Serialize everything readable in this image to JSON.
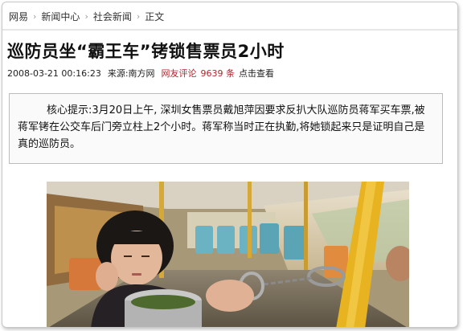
{
  "breadcrumb": {
    "items": [
      "网易",
      "新闻中心",
      "社会新闻",
      "正文"
    ],
    "separator": "›"
  },
  "article": {
    "title": "巡防员坐“霸王车”铐锁售票员2小时",
    "datetime": "2008-03-21 00:16:23",
    "source_label": "来源:",
    "source": "南方网",
    "comments_label": "网友评论",
    "comments_count": "9639 条",
    "comments_link": "点击查看",
    "summary": "核心提示:3月20日上午, 深圳女售票员戴旭萍因要求反扒大队巡防员蒋军买车票,被蒋军铐在公交车后门旁立柱上2个小时。蒋军称当时正在执勤,将她锁起来只是证明自己是真的巡防员。"
  },
  "photo": {
    "subject": "ticket seller handcuffed to bus pole"
  },
  "colors": {
    "accent_red": "#b2232a",
    "pole_yellow": "#e7b321"
  }
}
